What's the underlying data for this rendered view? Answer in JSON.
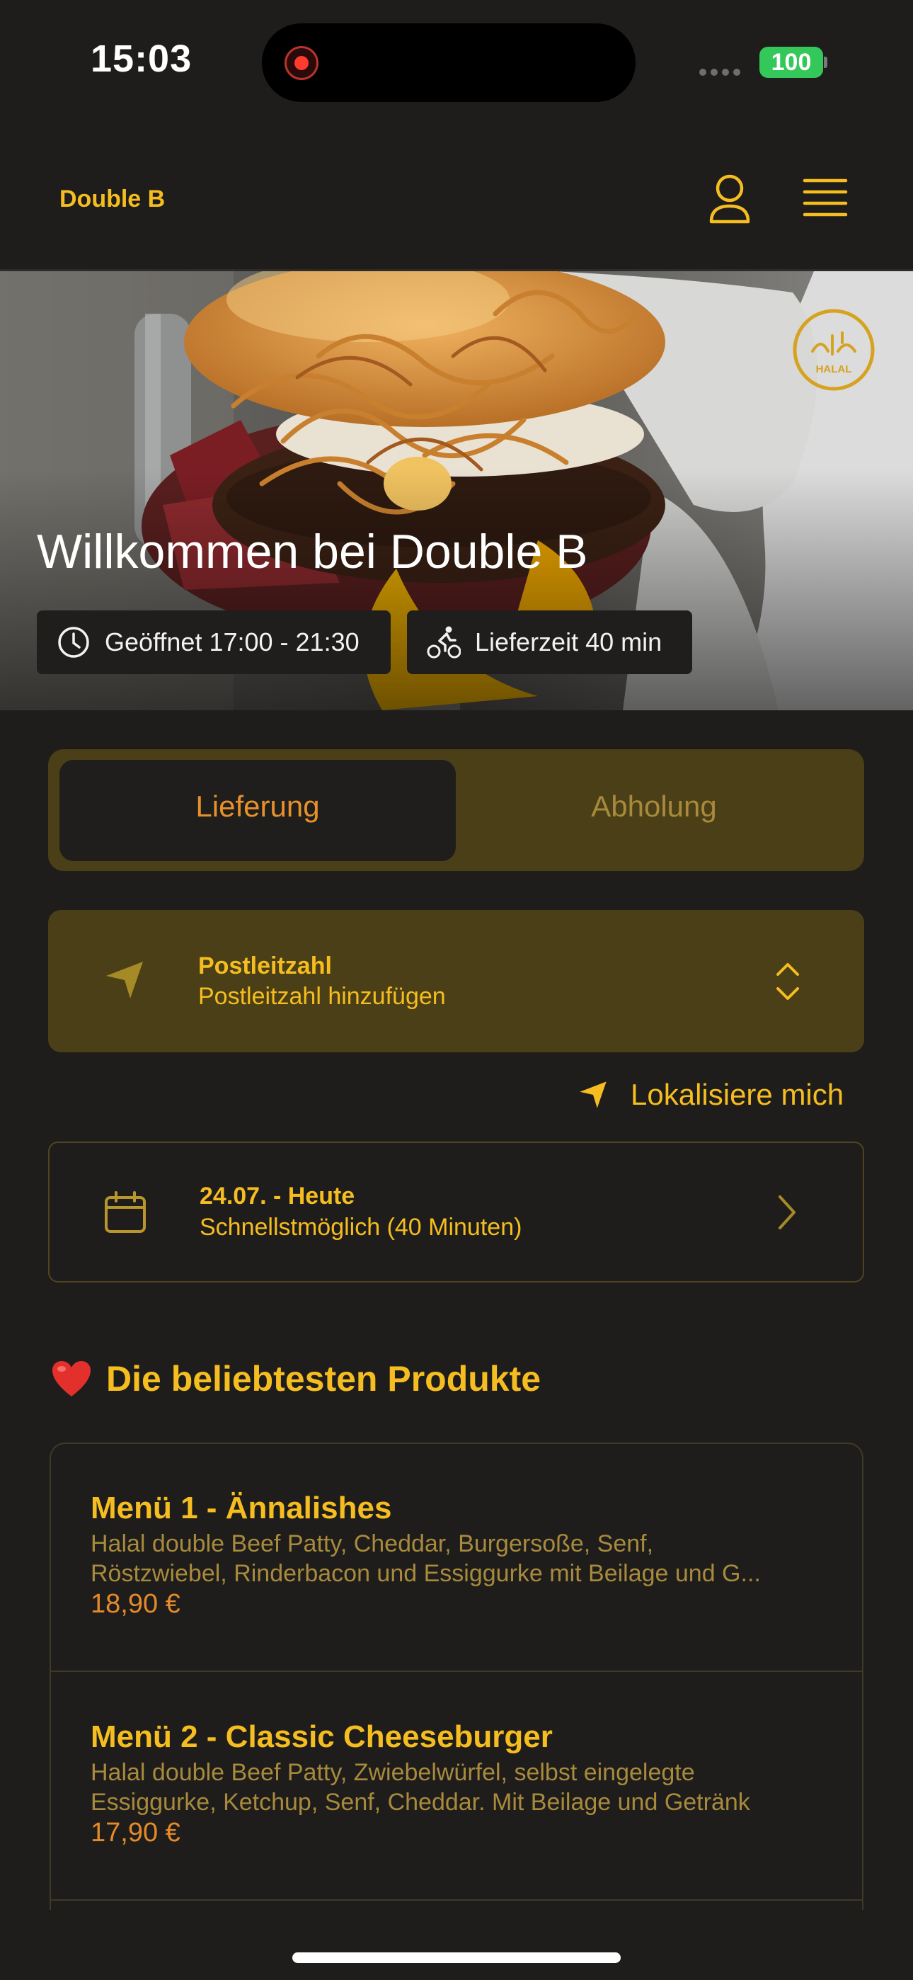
{
  "status_bar": {
    "time": "15:03",
    "battery": "100"
  },
  "header": {
    "brand": "Double B",
    "icons": [
      "user-icon",
      "menu-icon"
    ]
  },
  "hero": {
    "title": "Willkommen bei Double B",
    "opening": "Geöffnet 17:00 - 21:30",
    "delivery_time": "Lieferzeit 40 min",
    "badge": "HALAL"
  },
  "order_mode": {
    "options": [
      "Lieferung",
      "Abholung"
    ],
    "selected": "Lieferung"
  },
  "postal": {
    "title": "Postleitzahl",
    "placeholder": "Postleitzahl hinzufügen"
  },
  "locate_label": "Lokalisiere mich",
  "schedule": {
    "date": "24.07. - Heute",
    "time": "Schnellstmöglich (40 Minuten)"
  },
  "section_title": "Die beliebtesten Produkte",
  "products": [
    {
      "title": "Menü 1 - Ännalishes",
      "desc1": "Halal double Beef Patty, Cheddar, Burgersoße, Senf,",
      "desc2": "Röstzwiebel, Rinderbacon und Essiggurke mit Beilage und G...",
      "price": "18,90 €"
    },
    {
      "title": "Menü 2 - Classic Cheeseburger",
      "desc1": "Halal double Beef Patty, Zwiebelwürfel, selbst eingelegte",
      "desc2": "Essiggurke, Ketchup, Senf, Cheddar. Mit Beilage und Getränk",
      "price": "17,90 €"
    }
  ],
  "colors": {
    "accent": "#f5bd1f",
    "background": "#1e1d1c",
    "price": "#e48a2a",
    "panel": "#4a3f16"
  }
}
